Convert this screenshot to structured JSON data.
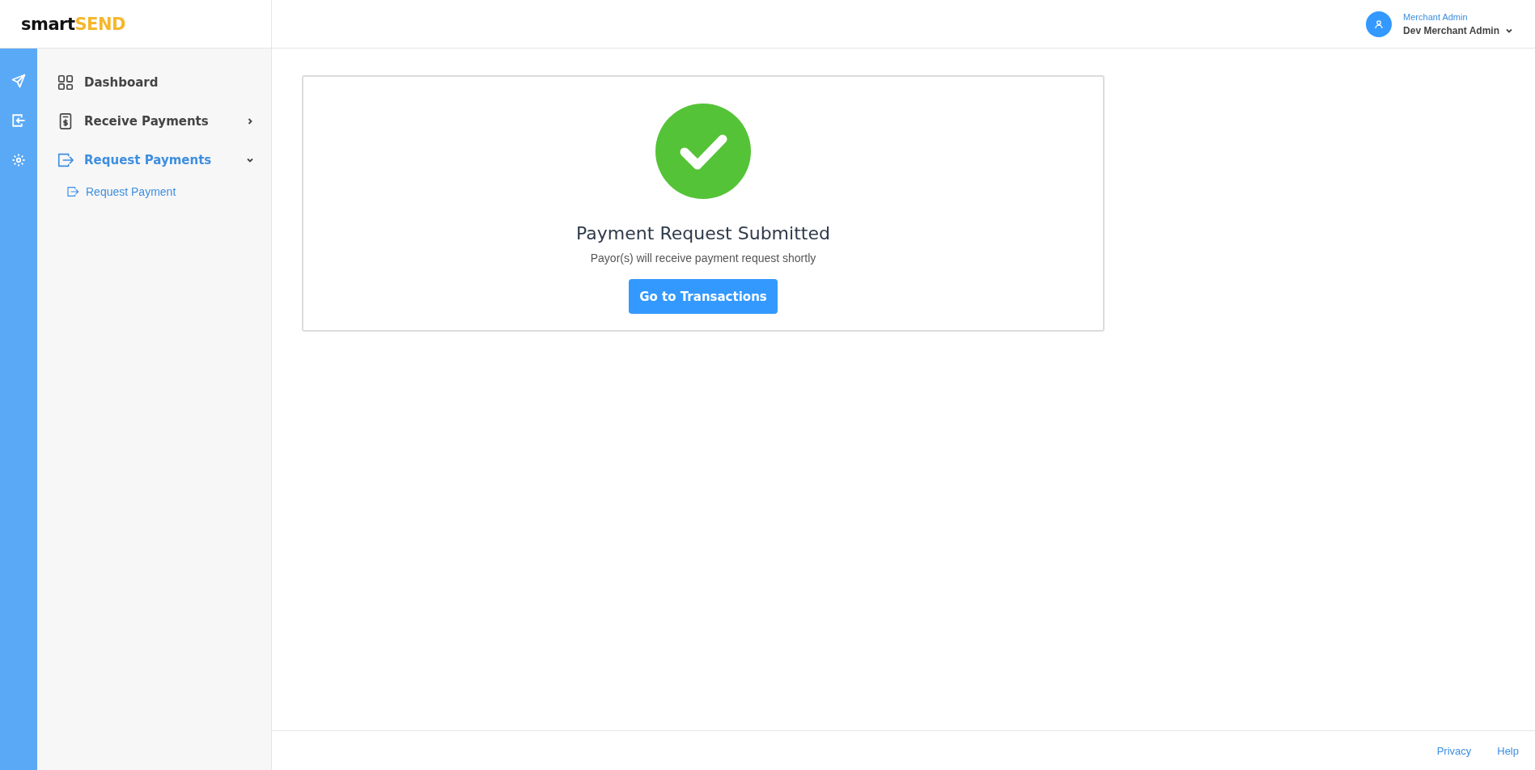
{
  "logo": {
    "first": "smart",
    "second": "SEND"
  },
  "user": {
    "role": "Merchant Admin",
    "name": "Dev Merchant Admin"
  },
  "sidebar": {
    "items": [
      {
        "label": "Dashboard",
        "selected": false
      },
      {
        "label": "Receive Payments",
        "selected": false,
        "expanded": false
      },
      {
        "label": "Request Payments",
        "selected": true,
        "expanded": true,
        "children": [
          {
            "label": "Request Payment",
            "selected": true
          }
        ]
      }
    ]
  },
  "card": {
    "title": "Payment Request Submitted",
    "message": "Payor(s) will receive payment request shortly",
    "button": "Go to Transactions"
  },
  "footer": {
    "links": [
      "Privacy",
      "Help"
    ]
  }
}
